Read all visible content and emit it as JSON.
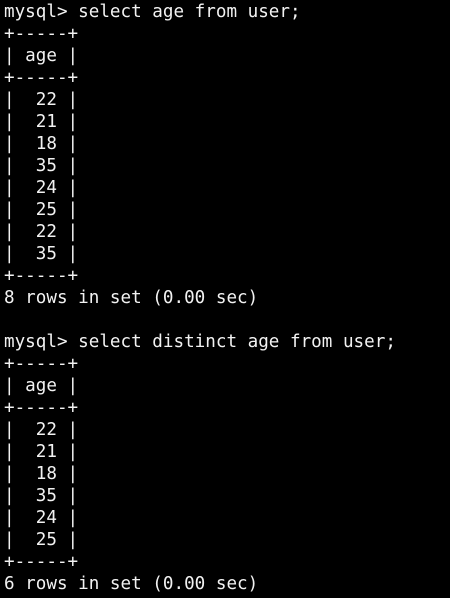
{
  "terminal": {
    "lines": [
      "mysql> select age from user;",
      "+-----+",
      "| age |",
      "+-----+",
      "|  22 |",
      "|  21 |",
      "|  18 |",
      "|  35 |",
      "|  24 |",
      "|  25 |",
      "|  22 |",
      "|  35 |",
      "+-----+",
      "8 rows in set (0.00 sec)",
      "",
      "mysql> select distinct age from user;",
      "+-----+",
      "| age |",
      "+-----+",
      "|  22 |",
      "|  21 |",
      "|  18 |",
      "|  35 |",
      "|  24 |",
      "|  25 |",
      "+-----+",
      "6 rows in set (0.00 sec)"
    ],
    "colors": {
      "background": "#000000",
      "foreground": "#f2f2f2"
    }
  }
}
